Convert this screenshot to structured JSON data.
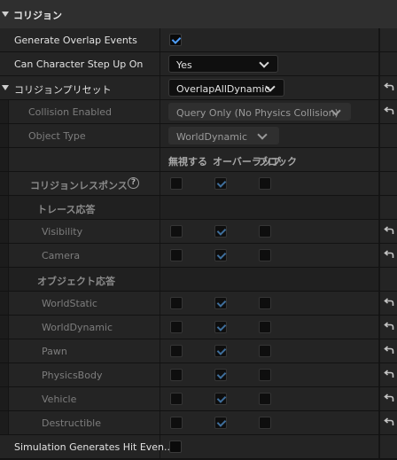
{
  "section": {
    "title": "コリジョン"
  },
  "generate_overlap": {
    "label": "Generate Overlap Events",
    "checked": true
  },
  "step_up": {
    "label": "Can Character Step Up On",
    "value": "Yes"
  },
  "preset": {
    "label": "コリジョンプリセット",
    "value": "OverlapAllDynamic"
  },
  "collision_enabled": {
    "label": "Collision Enabled",
    "value": "Query Only (No Physics Collision)"
  },
  "object_type": {
    "label": "Object Type",
    "value": "WorldDynamic"
  },
  "columns": {
    "ignore": "無視する",
    "overlap": "オーバーラップ",
    "block": "ブロック"
  },
  "responses": {
    "label": "コリジョンレスポンス",
    "help": "?"
  },
  "trace": {
    "label": "トレース応答",
    "items": [
      {
        "label": "Visibility",
        "state": "overlap"
      },
      {
        "label": "Camera",
        "state": "overlap"
      }
    ]
  },
  "object": {
    "label": "オブジェクト応答",
    "items": [
      {
        "label": "WorldStatic",
        "state": "overlap"
      },
      {
        "label": "WorldDynamic",
        "state": "overlap"
      },
      {
        "label": "Pawn",
        "state": "overlap"
      },
      {
        "label": "PhysicsBody",
        "state": "overlap"
      },
      {
        "label": "Vehicle",
        "state": "overlap"
      },
      {
        "label": "Destructible",
        "state": "overlap"
      }
    ]
  },
  "sim_hit": {
    "label": "Simulation Generates Hit Even...",
    "checked": false
  }
}
